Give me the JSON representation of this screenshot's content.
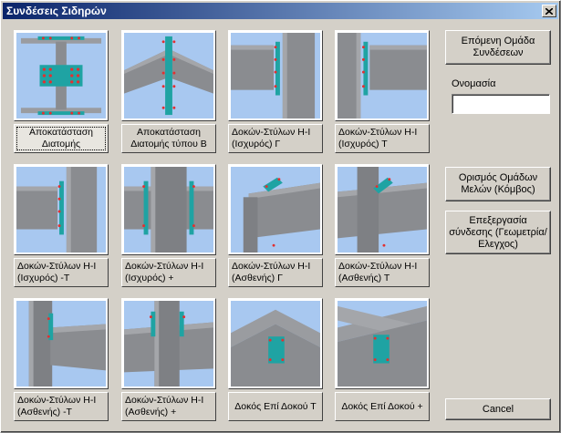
{
  "window": {
    "title": "Συνδέσεις Σιδηρών"
  },
  "tiles": [
    {
      "label": "Αποκατάσταση Διατομής",
      "selected": true,
      "icon": "section-splice-icon"
    },
    {
      "label": "Αποκατάσταση Διατομής τύπου Β",
      "icon": "section-splice-b-icon"
    },
    {
      "label": "Δοκών-Στύλων Η-Ι (Ισχυρός) Γ",
      "icon": "beam-column-strong-g-icon"
    },
    {
      "label": "Δοκών-Στύλων Η-Ι (Ισχυρός) Τ",
      "icon": "beam-column-strong-t-icon"
    },
    {
      "label": "Δοκών-Στύλων Η-Ι (Ισχυρός) -Τ",
      "icon": "beam-column-strong-neg-t-icon"
    },
    {
      "label": "Δοκών-Στύλων Η-Ι (Ισχυρός) +",
      "icon": "beam-column-strong-plus-icon"
    },
    {
      "label": "Δοκών-Στύλων Η-Ι (Ασθενής) Γ",
      "icon": "beam-column-weak-g-icon"
    },
    {
      "label": "Δοκών-Στύλων Η-Ι (Ασθενής) Τ",
      "icon": "beam-column-weak-t-icon"
    },
    {
      "label": "Δοκών-Στύλων Η-Ι (Ασθενής) -Τ",
      "icon": "beam-column-weak-neg-t-icon"
    },
    {
      "label": "Δοκών-Στύλων Η-Ι (Ασθενής) +",
      "icon": "beam-column-weak-plus-icon"
    },
    {
      "label": "Δοκός Επί Δοκού Τ",
      "icon": "beam-on-beam-t-icon"
    },
    {
      "label": "Δοκός Επί Δοκού +",
      "icon": "beam-on-beam-plus-icon"
    }
  ],
  "buttons": {
    "next_group": "Επόμενη Ομάδα Συνδέσεων",
    "define_groups": "Ορισμός Ομάδων Μελών (Κόμβος)",
    "edit_connection": "Επεξεργασία σύνδεσης (Γεωμετρία/Ελεγχος)",
    "cancel": "Cancel"
  },
  "name_field": {
    "label": "Ονομασία",
    "value": ""
  },
  "colors": {
    "steel": "#8a8c90",
    "plate": "#1fa3a3",
    "bolt": "#e23030",
    "sky": "#a8c8f0"
  }
}
